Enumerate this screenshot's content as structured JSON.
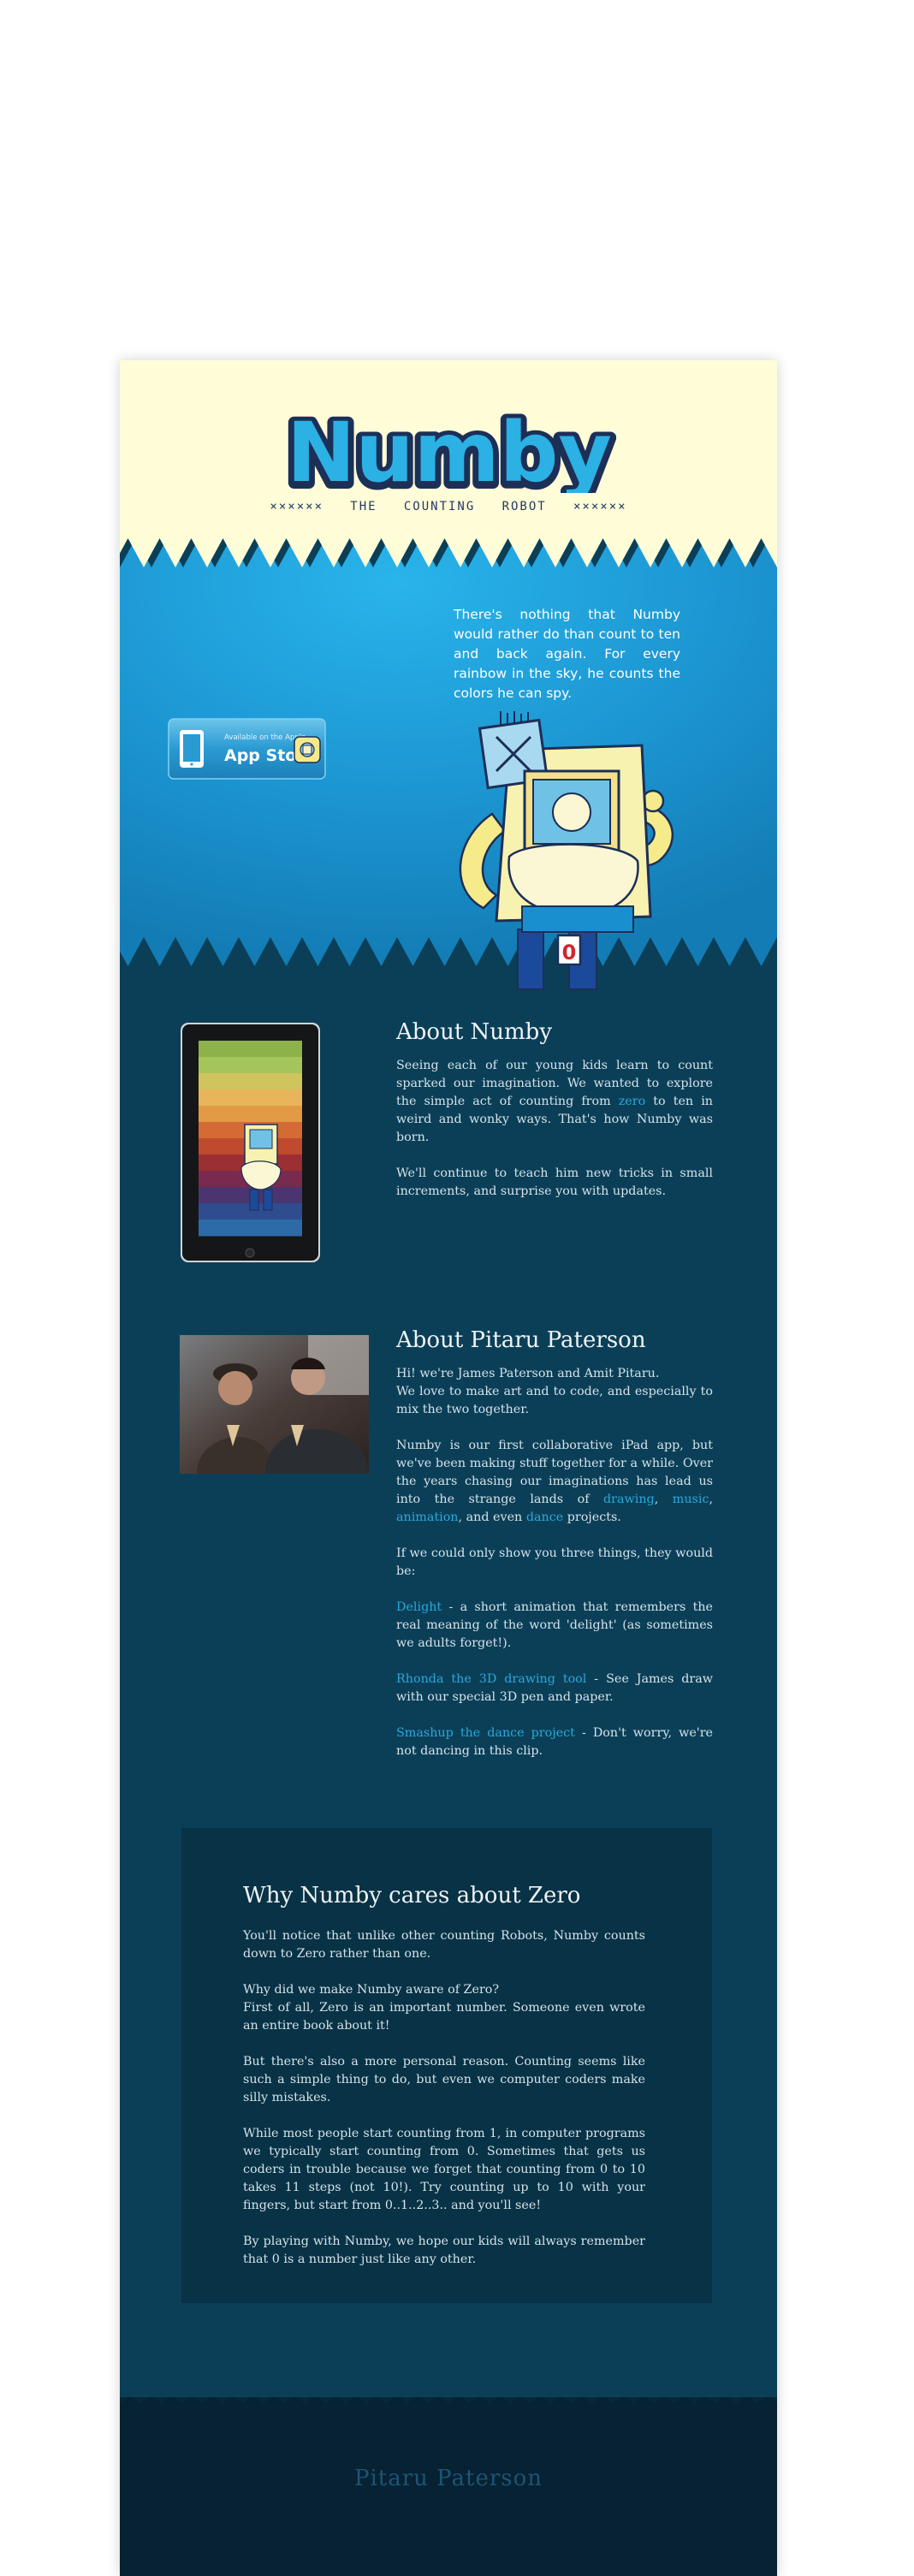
{
  "header": {
    "logo_text": "Numby",
    "tagline": "××××××   THE   COUNTING   ROBOT   ××××××"
  },
  "hero": {
    "intro": "There's nothing that Numby would rather do than count to ten and back again. For every rainbow in the sky, he counts the colors he can spy.",
    "app_store_small": "Available on the Apple",
    "app_store_big": "App Store",
    "robot_badge": "0"
  },
  "about_numby": {
    "title": "About Numby",
    "p1_before": "Seeing each of our young kids learn to count sparked our imagination. We wanted to explore the simple act of counting from ",
    "p1_link": "zero",
    "p1_after": " to ten in weird and wonky ways. That's how Numby was born.",
    "p2": "We'll continue to teach him new tricks in small increments, and surprise you with updates."
  },
  "about_pp": {
    "title": "About Pitaru Paterson",
    "intro_1": "Hi! we're James Paterson and Amit Pitaru.",
    "intro_2": "We love to make art and to code, and especially to mix the two together.",
    "p2_before": "Numby is our first collaborative iPad app, but we've been making stuff together for a while. Over the years chasing our imaginations has lead us into the strange lands of ",
    "link_drawing": "drawing",
    "sep1": ", ",
    "link_music": "music",
    "sep2": ", ",
    "link_animation": "animation",
    "sep3": ", and even ",
    "link_dance": "dance",
    "p2_after": " projects.",
    "p3": "If we could only show you three things, they would be:",
    "item1_link": "Delight",
    "item1_text": " - a short animation that remembers the real meaning of the word 'delight' (as sometimes we adults forget!).",
    "item2_link": "Rhonda the 3D drawing tool",
    "item2_text": " - See James draw with our special 3D pen and paper.",
    "item3_link": "Smashup the dance project",
    "item3_text": " - Don't worry, we're not dancing in this clip."
  },
  "zero": {
    "title": "Why Numby cares about Zero",
    "p1": "You'll notice that unlike other counting Robots, Numby counts down to Zero rather than one.",
    "p2_q": "Why did we make Numby aware of Zero?",
    "p2_a": "First of all, Zero is an important number. Someone even wrote an entire book about it!",
    "p3": "But there's also a more personal reason. Counting seems like such a simple thing to do, but even we computer coders make silly mistakes.",
    "p4": "While most people start counting from 1, in computer programs we typically start counting from 0. Sometimes that gets us coders in trouble because we forget that counting from 0 to 10 takes 11 steps (not 10!).  Try counting up to 10 with your fingers, but start from 0..1..2..3.. and you'll see!",
    "p5": "By playing with Numby, we hope our kids will always remember that 0 is a number just like any other."
  },
  "footer": {
    "text": "Pitaru  Paterson"
  },
  "colors": {
    "header_bg": "#fffcd8",
    "hero_blue": "#1a9ad6",
    "content_bg": "#0b3f58",
    "link": "#2ba8d9",
    "footer_bg": "#08283a"
  }
}
